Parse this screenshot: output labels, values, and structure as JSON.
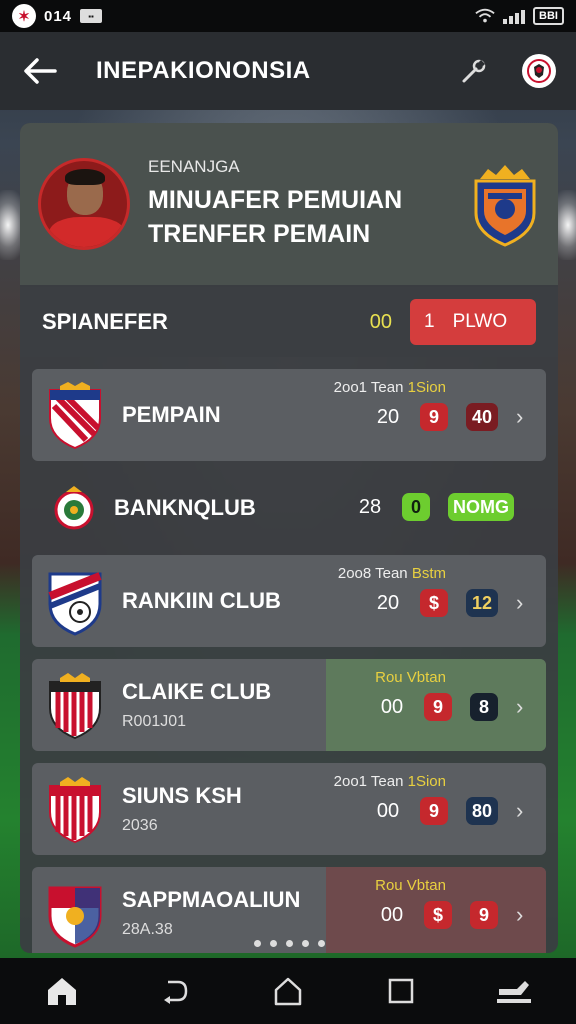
{
  "status_bar": {
    "logo_icon": "club-logo-icon",
    "time": "014",
    "notification_icon": "notification-icon",
    "battery": "BBI"
  },
  "app_bar": {
    "title": "INEPAKIONONSIA",
    "back_icon": "arrow-left-icon",
    "action_icon": "wrench-icon",
    "profile_icon": "club-badge-icon"
  },
  "hero": {
    "subtitle": "EENANJGA",
    "line1": "MINUAFER PEMUIAN",
    "line2": "TRENFER PEMAIN",
    "crest_icon": "team-crest-icon"
  },
  "section": {
    "title": "SPIANEFER",
    "count": "00",
    "button_num": "1",
    "button_label": "PLWO"
  },
  "clubs": [
    {
      "name": "PEMPAIN",
      "sub": "",
      "note": "2oo1 Tean",
      "note_hl": "1Sion",
      "stat": "20",
      "pill1": "9",
      "pill2": "40",
      "highlight": ""
    },
    {
      "name": "BANKNQLUB",
      "sub": "",
      "note": "",
      "note_hl": "",
      "stat": "28",
      "pill1": "0",
      "pill2": "NOMG",
      "highlight": ""
    },
    {
      "name": "RANKIIN CLUB",
      "sub": "",
      "note": "2oo8 Tean",
      "note_hl": "Bstm",
      "stat": "20",
      "pill1": "$",
      "pill2": "12",
      "highlight": ""
    },
    {
      "name": "CLAIKE CLUB",
      "sub": "R001J01",
      "note": "",
      "note_hl": "Rou Vbtan",
      "stat": "00",
      "pill1": "9",
      "pill2": "8",
      "highlight": "green"
    },
    {
      "name": "SIUNS KSH",
      "sub": "2036",
      "note": "2oo1 Tean",
      "note_hl": "1Sion",
      "stat": "00",
      "pill1": "9",
      "pill2": "80",
      "highlight": ""
    },
    {
      "name": "SAPPMAOALIUN",
      "sub": "28A.38",
      "note": "",
      "note_hl": "Rou Vbtan",
      "stat": "00",
      "pill1": "$",
      "pill2": "9",
      "highlight": "red"
    }
  ],
  "nav": {
    "home_icon": "home-icon",
    "back_icon": "back-nav-icon",
    "recents_home_icon": "house-outline-icon",
    "overview_icon": "square-icon",
    "app_icon": "app-switch-icon"
  },
  "colors": {
    "accent_red": "#d43d3d",
    "accent_green": "#6dcd2f",
    "count_yellow": "#e8e050"
  }
}
